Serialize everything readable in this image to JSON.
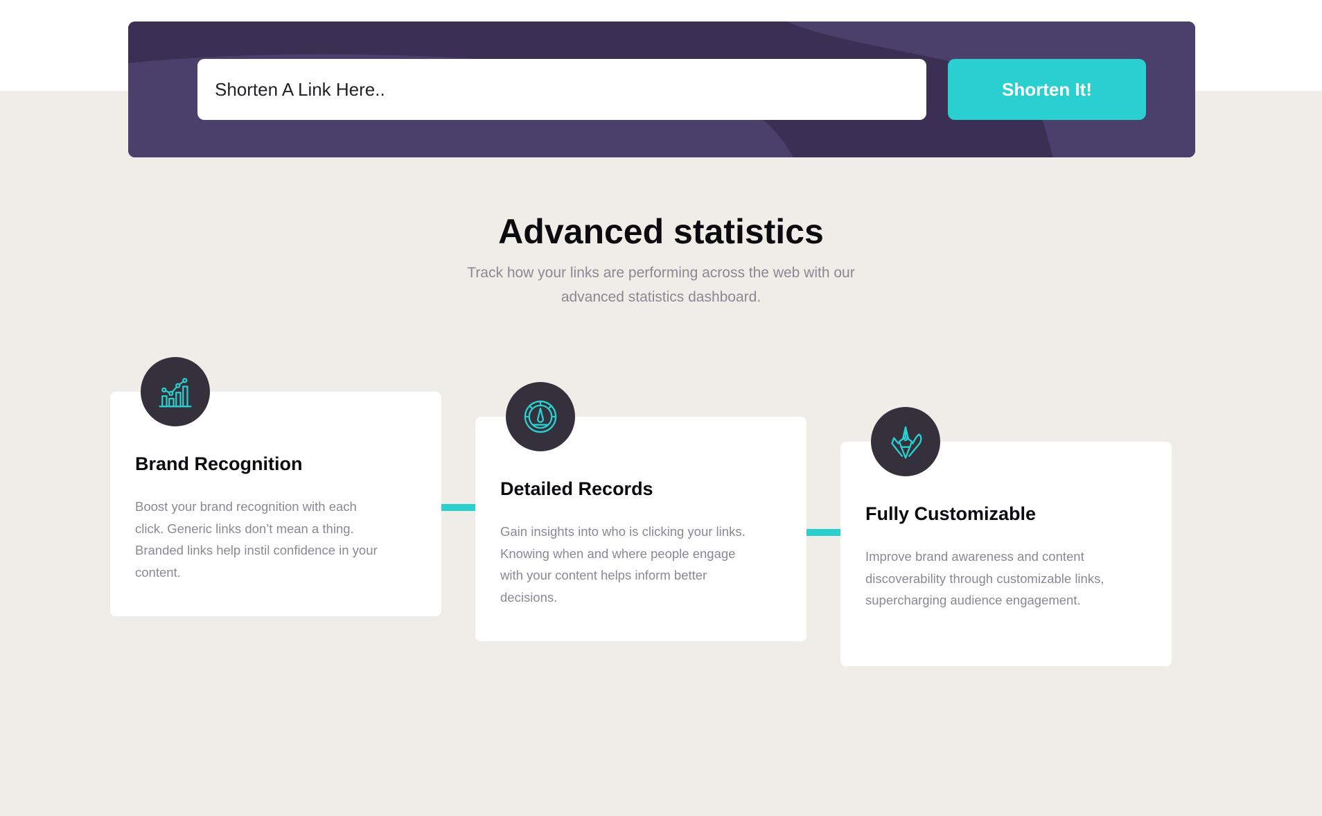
{
  "shortener": {
    "input_placeholder": "Shorten A Link Here..",
    "button_label": "Shorten It!"
  },
  "statistics": {
    "title": "Advanced statistics",
    "subtitle": "Track how your links are performing across the web with our advanced statistics dashboard."
  },
  "features": [
    {
      "title": "Brand Recognition",
      "text": "Boost your brand recognition with each click. Generic links don’t mean a thing. Branded links help instil confidence in your content.",
      "icon": "bar-chart-icon"
    },
    {
      "title": "Detailed Records",
      "text": "Gain insights into who is clicking your links. Knowing when and where people engage with your content helps inform better decisions.",
      "icon": "gauge-icon"
    },
    {
      "title": "Fully Customizable",
      "text": "Improve brand awareness and content discoverability through customizable links, supercharging audience engagement.",
      "icon": "brush-pen-icon"
    }
  ],
  "colors": {
    "accent": "#2acfcf",
    "dark_violet": "#3b3054",
    "icon_circle": "#34313d",
    "background": "#eeede8"
  }
}
